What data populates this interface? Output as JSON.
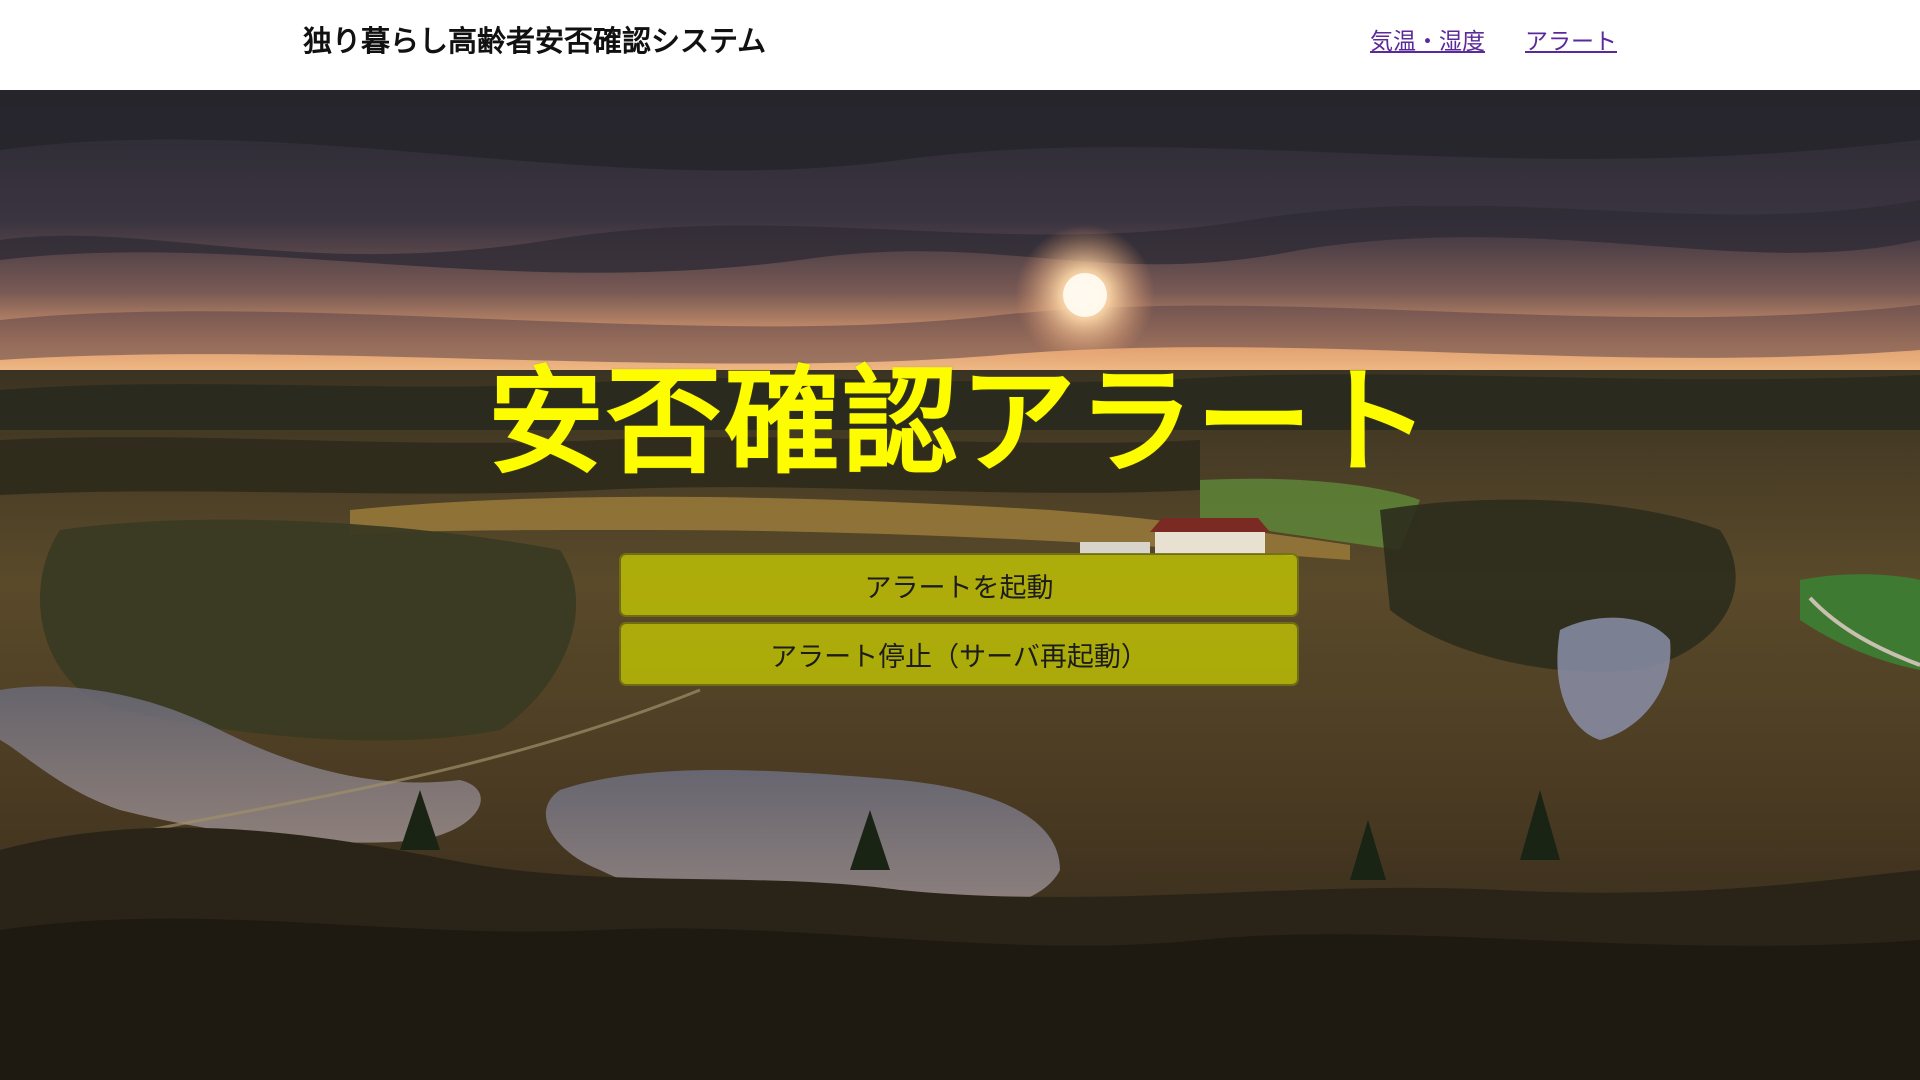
{
  "header": {
    "title": "独り暮らし高齢者安否確認システム",
    "nav": [
      {
        "label": "気温・湿度"
      },
      {
        "label": "アラート"
      }
    ]
  },
  "hero": {
    "title": "安否確認アラート",
    "title_color": "#fdfd00",
    "background": "landscape photo: storm clouds, setting sun, forested valley with ponds and farmhouse"
  },
  "buttons": {
    "start_label": "アラートを起動",
    "stop_label": "アラート停止（サーバ再起動）",
    "button_color": "#cdd200"
  }
}
